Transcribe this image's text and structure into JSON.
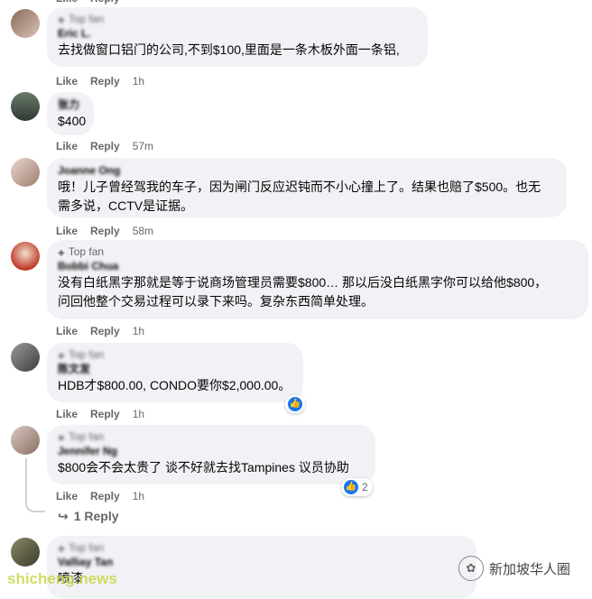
{
  "labels": {
    "like": "Like",
    "reply": "Reply",
    "top_fan": "Top fan"
  },
  "comments": [
    {
      "name": "Eric L.",
      "text": "去找做窗口铝门的公司,不到$100,里面是一条木板外面一条铝,",
      "time": "1h"
    },
    {
      "name": "张力",
      "text": "$400",
      "time": "57m"
    },
    {
      "name": "Joanne Ong",
      "text1": "哦！儿子曾经驾我的车子，因为闸门反应迟钝而不小心撞上了。结果也赔了$500。也无",
      "text2": "需多说，CCTV是证据。",
      "time": "58m"
    },
    {
      "name": "Bobbi Chua",
      "text1": "没有白纸黑字那就是等于说商场管理员需要$800… 那以后没白纸黑字你可以给他$800，",
      "text2": "问回他整个交易过程可以录下来吗。复杂东西简单处理。",
      "time": "1h"
    },
    {
      "name": "陈文发",
      "text": "HDB才$800.00, CONDO要你$2,000.00。",
      "time": "1h"
    },
    {
      "name": "Jennifer Ng",
      "text": "$800会不会太贵了 谈不好就去找Tampines 议员协助",
      "time": "1h",
      "reactions": "2"
    },
    {
      "name": "Valliay Tan",
      "text": "喷漆"
    }
  ],
  "replies_link": "1 Reply",
  "watermark": {
    "left": "shicheng.news",
    "right": "新加坡华人圈"
  }
}
